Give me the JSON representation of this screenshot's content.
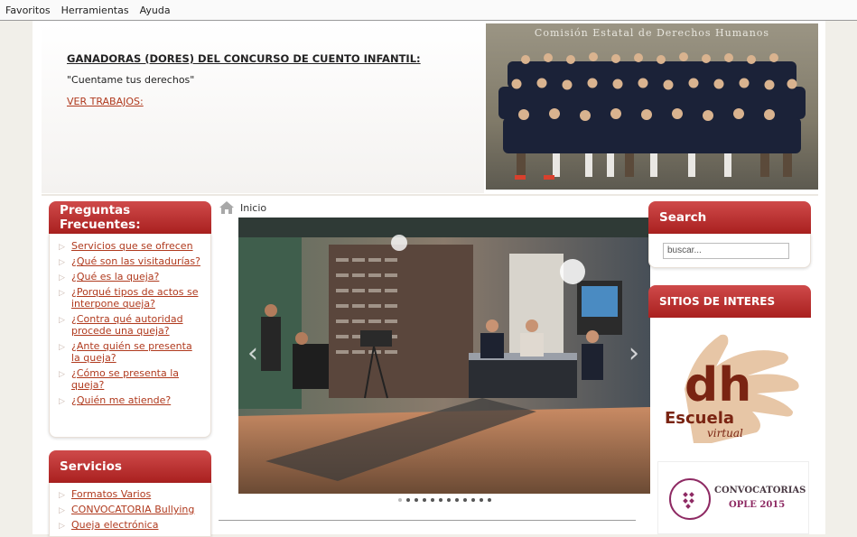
{
  "menubar": {
    "items": [
      "Favoritos",
      "Herramientas",
      "Ayuda"
    ]
  },
  "banner": {
    "title": "GANADORAS (DORES) DEL CONCURSO DE CUENTO INFANTIL:",
    "subtitle": "\"Cuentame tus derechos\"",
    "link": "VER TRABAJOS:"
  },
  "group_photo": {
    "caption": "Comisión Estatal de Derechos Humanos"
  },
  "faq": {
    "title": "Preguntas Frecuentes:",
    "items": [
      "Servicios que se ofrecen",
      "¿Qué son las visitadurías?",
      "¿Qué es la queja?",
      "¿Porqué tipos de actos se interpone queja?",
      "¿Contra qué autoridad procede una queja?",
      "¿Ante quién se presenta la queja?",
      "¿Cómo se presenta la queja?",
      "¿Quién me atiende?"
    ]
  },
  "services": {
    "title": "Servicios",
    "items": [
      "Formatos Varios",
      "CONVOCATORIA Bullying",
      "Queja electrónica"
    ]
  },
  "breadcrumb": {
    "home": "Inicio"
  },
  "slider": {
    "slide_count": 12,
    "active_index": 0
  },
  "search": {
    "title": "Search",
    "placeholder": "buscar..."
  },
  "sites": {
    "title": "SITIOS DE INTERES",
    "dh": {
      "letters": "dh",
      "word": "Escuela",
      "sub": "virtual"
    },
    "ople": {
      "line1": "CONVOCATORIAS",
      "line2": "OPLE 2015"
    }
  },
  "colors": {
    "header_red": "#b52a2a",
    "link": "#b03a1e"
  }
}
